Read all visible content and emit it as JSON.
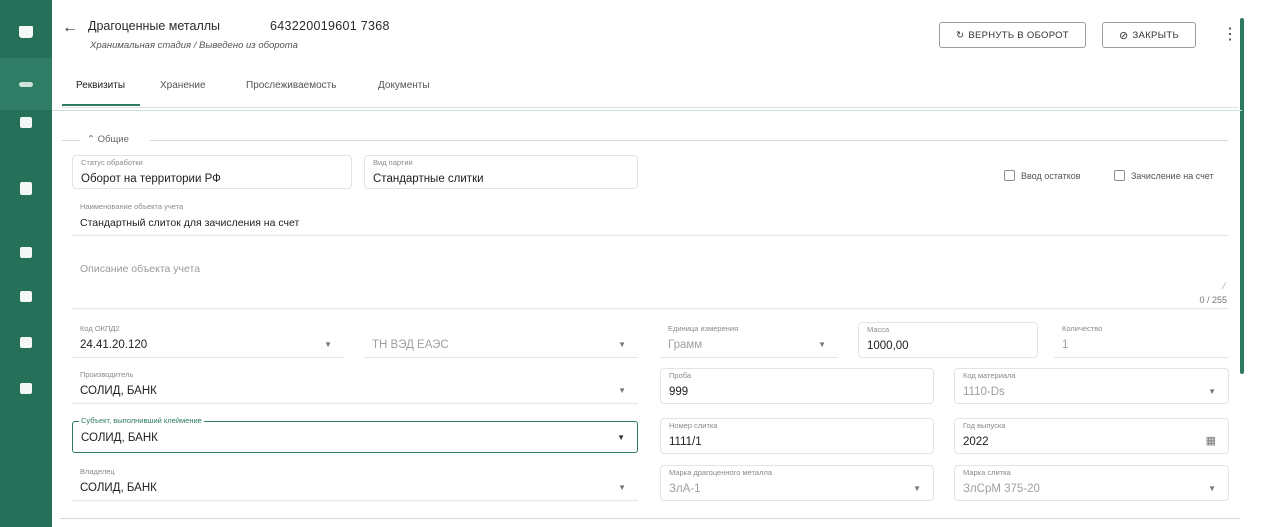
{
  "rail": {
    "icons": [
      "cart-icon",
      "wave-icon",
      "card-icon",
      "clipboard-icon",
      "grid-icon",
      "mail-icon",
      "checklist-icon",
      "building-icon"
    ]
  },
  "header": {
    "title": "Драгоценные металлы",
    "code": "643220019601 7368",
    "breadcrumb": "Хранимальная стадия / Выведено из оборота",
    "return_button": "ВЕРНУТЬ В ОБОРОТ",
    "close_button": "ЗАКРЫТЬ"
  },
  "tabs": [
    "Реквизиты",
    "Хранение",
    "Прослеживаемость",
    "Документы"
  ],
  "section": {
    "title": "Общие"
  },
  "fields": {
    "processing_status": {
      "label": "Статус обработки",
      "value": "Оборот на территории РФ"
    },
    "kind": {
      "label": "Вид партии",
      "value": "Стандартные слитки"
    },
    "flag1": "Ввод остатков",
    "flag2": "Зачисление на счет",
    "name": {
      "label": "Наименование объекта учета",
      "value": "Стандартный слиток для зачисления на счет"
    },
    "description_placeholder": "Описание объекта учета",
    "description_counter": "0 / 255",
    "okpd": {
      "label": "Код ОКПД2",
      "value": "24.41.20.120"
    },
    "tnved": {
      "label": "",
      "value": "ТН ВЭД ЕАЭС"
    },
    "unit": {
      "label": "Единица измерения",
      "value": "Грамм"
    },
    "mass": {
      "label": "Масса",
      "value": "1000,00"
    },
    "quantity": {
      "label": "Количество",
      "value": "1"
    },
    "manufacturer": {
      "label": "Производитель",
      "value": "СОЛИД, БАНК"
    },
    "probe": {
      "label": "Проба",
      "value": "999"
    },
    "material_code": {
      "label": "Код материала",
      "value": "1110-Ds"
    },
    "hallmark_org": {
      "label": "Субъект, выполнивший клеймение",
      "value": "СОЛИД, БАНК"
    },
    "bar_number": {
      "label": "Номер слитка",
      "value": "1111/1"
    },
    "year": {
      "label": "Год выпуска",
      "value": "2022"
    },
    "owner": {
      "label": "Владелец",
      "value": "СОЛИД, БАНК"
    },
    "metal_brand": {
      "label": "Марка драгоценного металла",
      "value": "ЗлА-1"
    },
    "brand_standard": {
      "label": "Марка слитка",
      "value": "ЗлСрМ 375-20"
    }
  }
}
